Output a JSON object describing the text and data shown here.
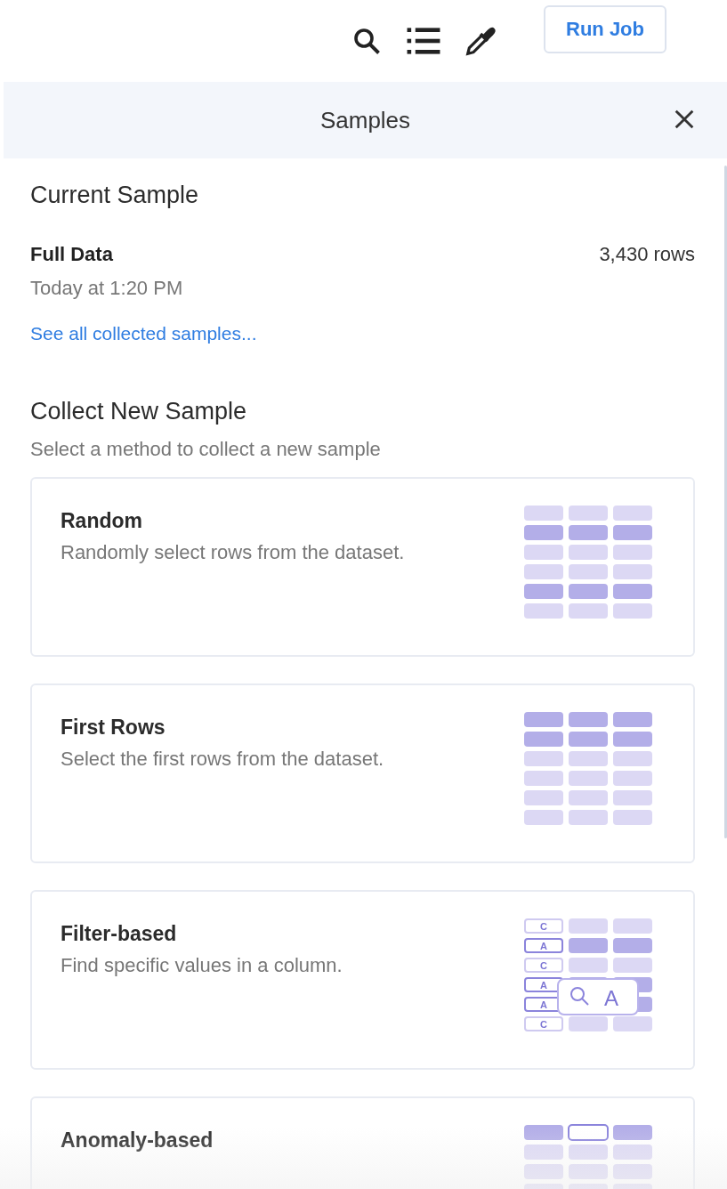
{
  "toolbar": {
    "run_button": "Run Job"
  },
  "panel": {
    "title": "Samples",
    "current": {
      "heading": "Current Sample",
      "name": "Full Data",
      "rows": "3,430 rows",
      "time": "Today at 1:20 PM",
      "link": "See all collected samples..."
    },
    "collect": {
      "heading": "Collect New Sample",
      "subtitle": "Select a method to collect a new sample",
      "methods": [
        {
          "kind": "random",
          "title": "Random",
          "description": "Randomly select rows from the dataset."
        },
        {
          "kind": "first",
          "title": "First Rows",
          "description": "Select the first rows from the dataset."
        },
        {
          "kind": "filter",
          "title": "Filter-based",
          "description": "Find specific values in a column.",
          "tags": [
            "C",
            "A",
            "C",
            "A",
            "A",
            "C"
          ],
          "search_label": "A"
        },
        {
          "kind": "anomaly",
          "title": "Anomaly-based"
        }
      ]
    }
  }
}
